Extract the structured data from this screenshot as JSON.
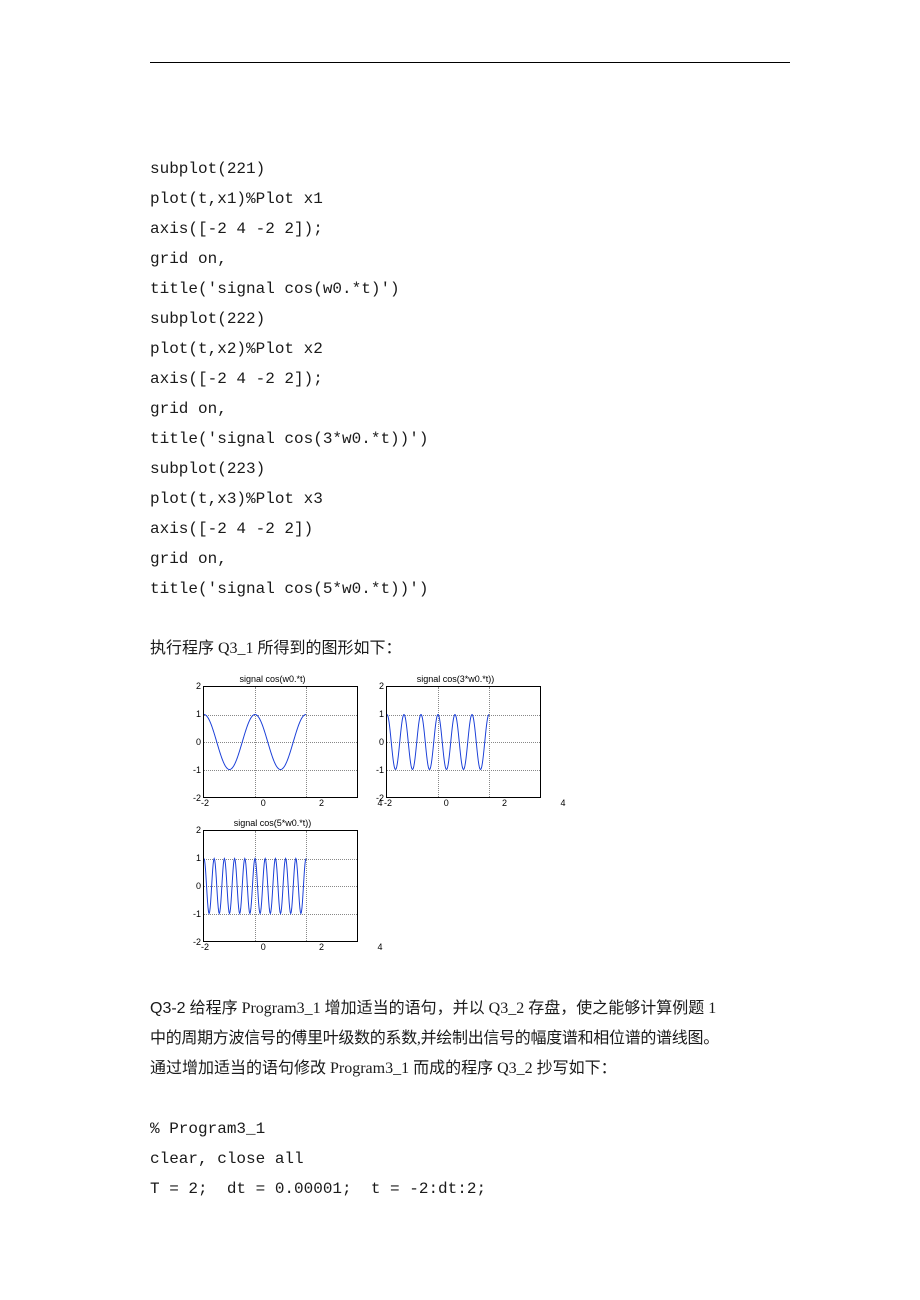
{
  "code": {
    "l1": "subplot(221)",
    "l2": "plot(t,x1)%Plot x1",
    "l3": "axis([-2 4 -2 2]);",
    "l4": "grid on,",
    "l5": "title('signal cos(w0.*t)')",
    "l6": "subplot(222)",
    "l7": "plot(t,x2)%Plot x2",
    "l8": "axis([-2 4 -2 2]);",
    "l9": "grid on,",
    "l10": "title('signal cos(3*w0.*t))')",
    "l11": "subplot(223)",
    "l12": "plot(t,x3)%Plot x3",
    "l13": "axis([-2 4 -2 2])",
    "l14": "grid on,",
    "l15": "title('signal cos(5*w0.*t))')"
  },
  "caption1": "执行程序 Q3_1 所得到的图形如下：",
  "chart_data": [
    {
      "type": "line",
      "title": "signal cos(w0.*t)",
      "xlim": [
        -2,
        4
      ],
      "ylim": [
        -2,
        2
      ],
      "xticks": [
        -2,
        0,
        2,
        4
      ],
      "yticks": [
        -2,
        -1,
        0,
        1,
        2
      ],
      "function": "cos(pi*t)",
      "domain": [
        -2,
        2
      ]
    },
    {
      "type": "line",
      "title": "signal cos(3*w0.*t))",
      "xlim": [
        -2,
        4
      ],
      "ylim": [
        -2,
        2
      ],
      "xticks": [
        -2,
        0,
        2,
        4
      ],
      "yticks": [
        -2,
        -1,
        0,
        1,
        2
      ],
      "function": "cos(3*pi*t)",
      "domain": [
        -2,
        2
      ]
    },
    {
      "type": "line",
      "title": "signal cos(5*w0.*t))",
      "xlim": [
        -2,
        4
      ],
      "ylim": [
        -2,
        2
      ],
      "xticks": [
        -2,
        0,
        2,
        4
      ],
      "yticks": [
        -2,
        -1,
        0,
        1,
        2
      ],
      "function": "cos(5*pi*t)",
      "domain": [
        -2,
        2
      ]
    }
  ],
  "q32": {
    "label": "Q3-2",
    "p1_a": "给程序 Program3_1 增加适当的语句，并以 Q3_2 存盘，使之能够计算例题 1",
    "p1_b": "中的周期方波信号的傅里叶级数的系数,并绘制出信号的幅度谱和相位谱的谱线图。",
    "p2": "通过增加适当的语句修改 Program3_1 而成的程序 Q3_2 抄写如下：",
    "c1": "% Program3_1",
    "c2": "clear, close all",
    "c3": "T = 2;  dt = 0.00001;  t = -2:dt:2;"
  }
}
